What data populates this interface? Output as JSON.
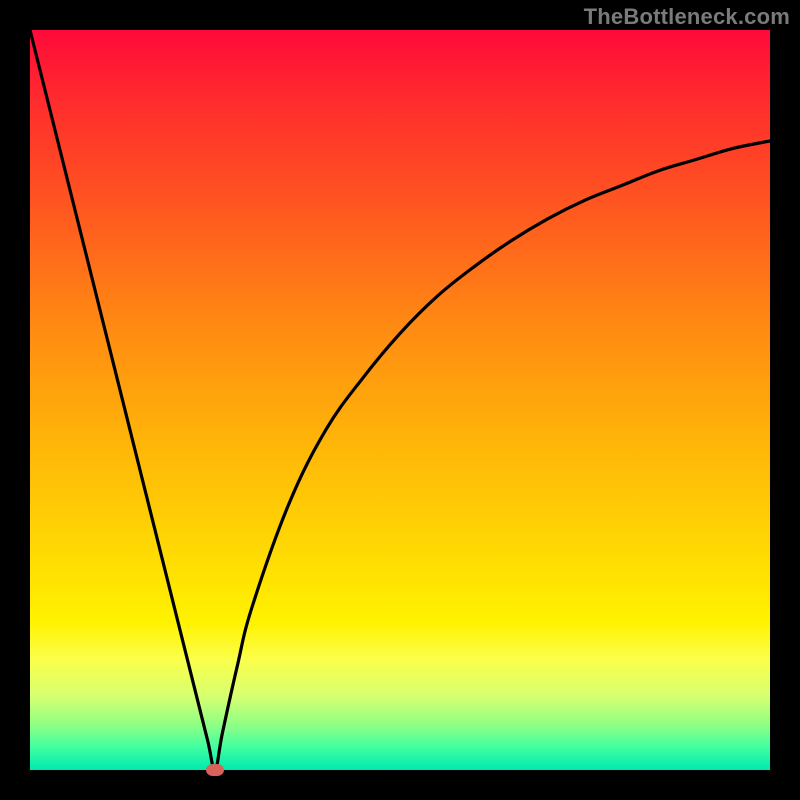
{
  "watermark": "TheBottleneck.com",
  "chart_data": {
    "type": "line",
    "title": "",
    "xlabel": "",
    "ylabel": "",
    "xlim": [
      0,
      100
    ],
    "ylim": [
      0,
      100
    ],
    "grid": false,
    "series": [
      {
        "name": "curve",
        "x": [
          0,
          5,
          10,
          15,
          20,
          22,
          24,
          25,
          26,
          28,
          30,
          35,
          40,
          45,
          50,
          55,
          60,
          65,
          70,
          75,
          80,
          85,
          90,
          95,
          100
        ],
        "values": [
          100,
          80,
          60,
          40,
          20,
          12,
          4,
          0,
          5,
          14,
          22,
          36,
          46,
          53,
          59,
          64,
          68,
          71.5,
          74.5,
          77,
          79,
          81,
          82.5,
          84,
          85
        ]
      }
    ],
    "marker": {
      "x": 25,
      "y": 0,
      "color": "#d9625a"
    },
    "background_gradient": {
      "top": "#ff0a3a",
      "bottom": "#00e8b0"
    }
  }
}
